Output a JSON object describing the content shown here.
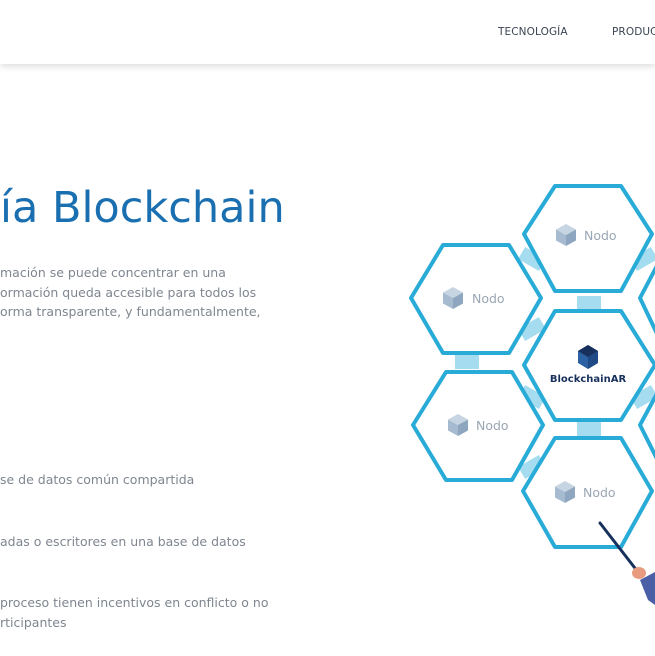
{
  "header": {
    "nav": [
      {
        "label": "TECNOLOGÍA"
      },
      {
        "label": "PRODUC"
      }
    ]
  },
  "hero": {
    "title": "ía Blockchain",
    "intro_lines": [
      "mación se puede concentrar en una",
      "ormación queda accesible para todos los",
      "orma transparente, y fundamentalmente,"
    ]
  },
  "bullets": [
    {
      "lines": [
        "se de datos común compartida"
      ]
    },
    {
      "lines": [
        "adas o escritores en una base de datos"
      ]
    },
    {
      "lines": [
        "proceso tienen incentivos en conflicto o no",
        "rticipantes"
      ]
    }
  ],
  "diagram": {
    "nodes": [
      {
        "label": "Nodo"
      },
      {
        "label": "Nodo"
      },
      {
        "label": "Nodo"
      },
      {
        "label": "Nodo"
      }
    ],
    "center": {
      "label": "BlockchainAR"
    },
    "colors": {
      "hex_stroke": "#29abd8",
      "connector": "#a6dcf0",
      "cube_top": "#c7d5e3",
      "cube_left": "#a7bbd0",
      "cube_right": "#8ea6bf",
      "brand_dark": "#17305c",
      "brand_mid": "#2c61a3",
      "title_blue": "#1a6fb0"
    }
  }
}
